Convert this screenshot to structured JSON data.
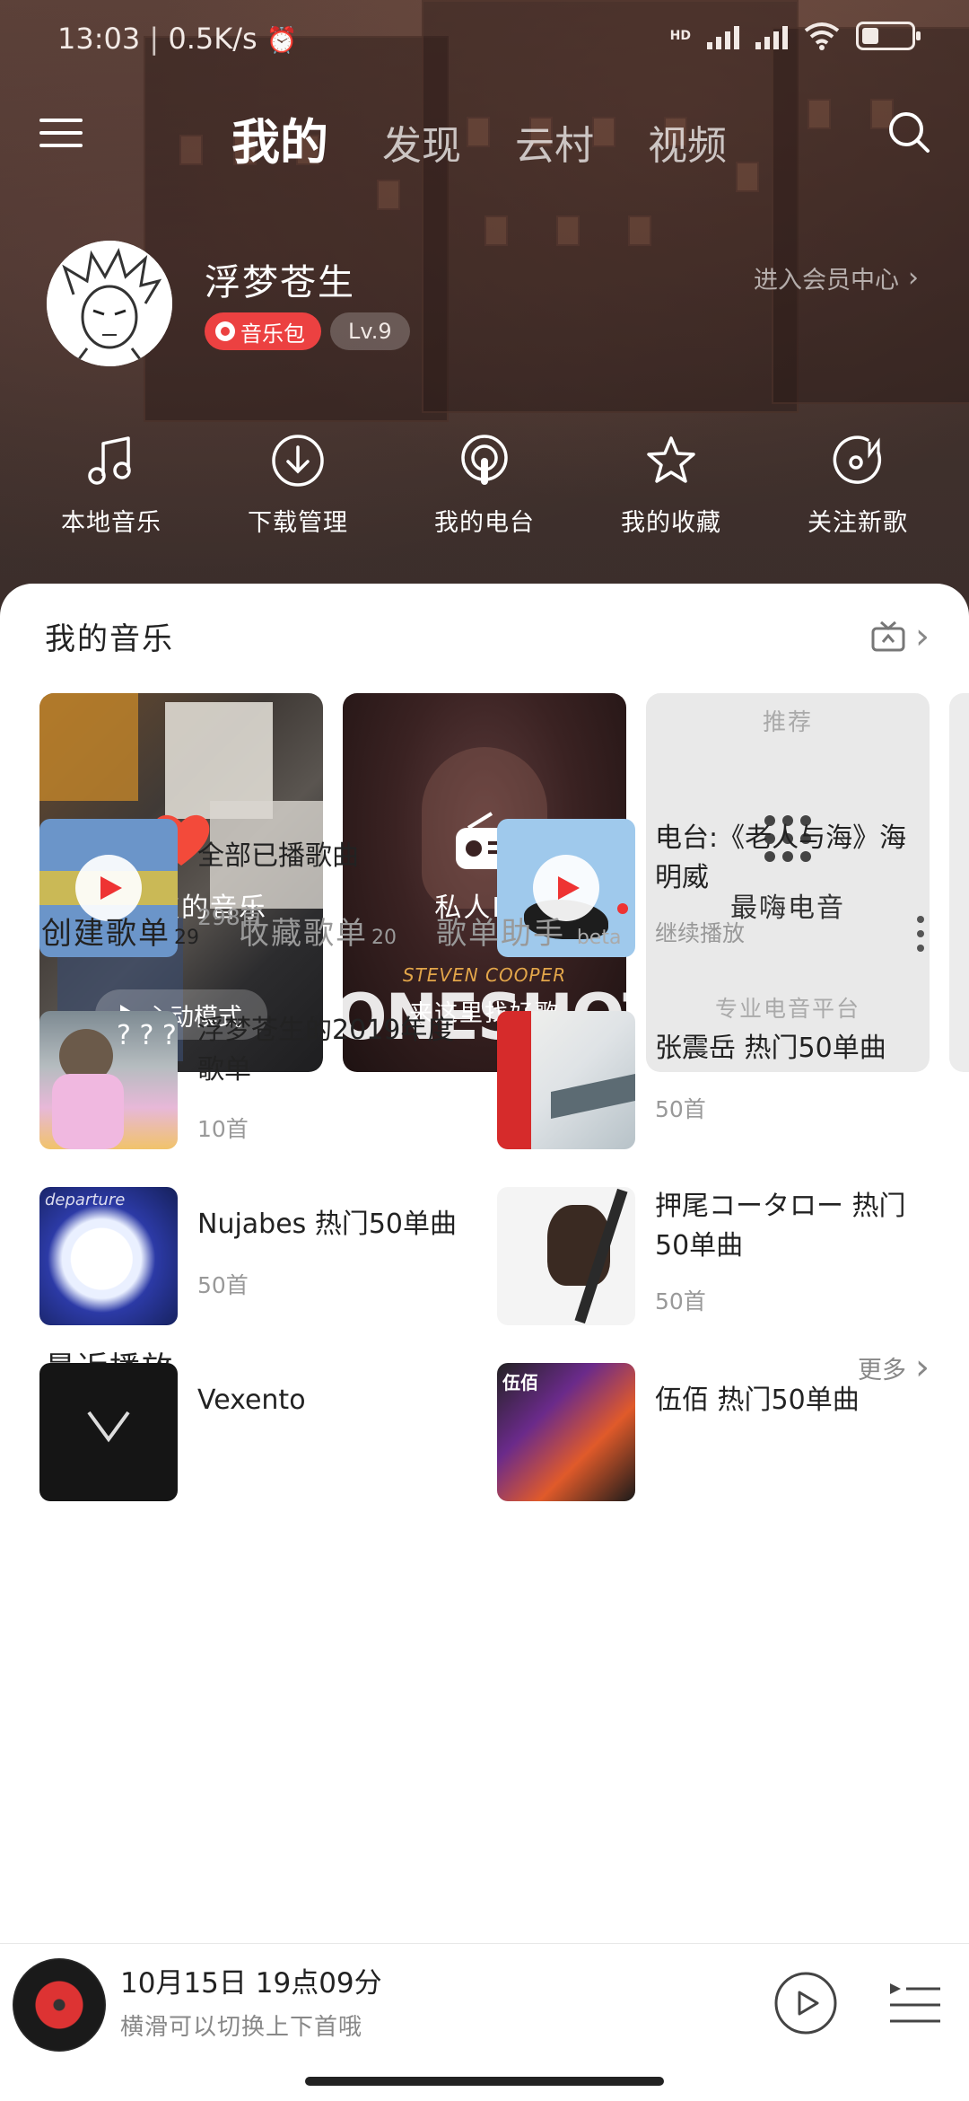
{
  "status": {
    "time": "13:03",
    "speed": "0.5K/s",
    "network_tag": "HD"
  },
  "nav": {
    "tabs": [
      "我的",
      "发现",
      "云村",
      "视频"
    ],
    "active_tab": "我的"
  },
  "profile": {
    "name": "浮梦苍生",
    "music_pack": "音乐包",
    "level": "Lv.9",
    "vip_link": "进入会员中心"
  },
  "quick_actions": [
    {
      "label": "本地音乐",
      "icon": "music-note-icon"
    },
    {
      "label": "下载管理",
      "icon": "download-icon"
    },
    {
      "label": "我的电台",
      "icon": "podcast-icon"
    },
    {
      "label": "我的收藏",
      "icon": "star-icon"
    },
    {
      "label": "关注新歌",
      "icon": "new-song-icon"
    }
  ],
  "my_music": {
    "title": "我的音乐",
    "cards": {
      "liked": {
        "title": "我喜欢的音乐",
        "button": "心动模式"
      },
      "fm": {
        "title": "私人FM",
        "subtitle": "来这里找好歌",
        "album_art_text": "ONESHOT",
        "album_artist": "STEVEN COOPER"
      },
      "edm": {
        "tag": "推荐",
        "title": "最嗨电音",
        "subtitle": "专业电音平台"
      }
    }
  },
  "recent": {
    "title": "最近播放",
    "more": "更多",
    "items": [
      {
        "title": "全部已播歌曲",
        "sub": "298首"
      },
      {
        "title": "电台:《老人与海》海明威",
        "sub": "继续播放"
      }
    ]
  },
  "playlists": {
    "tabs": [
      {
        "label": "创建歌单",
        "count": "29"
      },
      {
        "label": "收藏歌单",
        "count": "20"
      },
      {
        "label": "歌单助手",
        "tag": "beta"
      }
    ],
    "items": [
      {
        "title": "浮梦苍生的2019年度歌单",
        "sub": "10首"
      },
      {
        "title": "张震岳 热门50单曲",
        "sub": "50首"
      },
      {
        "title": "Nujabes 热门50单曲",
        "sub": "50首"
      },
      {
        "title": "押尾コータロー 热门50单曲",
        "sub": "50首"
      },
      {
        "title": "Vexento",
        "sub": ""
      },
      {
        "title": "伍佰 热门50单曲",
        "sub": ""
      }
    ]
  },
  "player": {
    "title": "10月15日 19点09分",
    "subtitle": "横滑可以切换上下首哦"
  },
  "colors": {
    "accent": "#ec4141",
    "header_bg": "#4a3530"
  }
}
